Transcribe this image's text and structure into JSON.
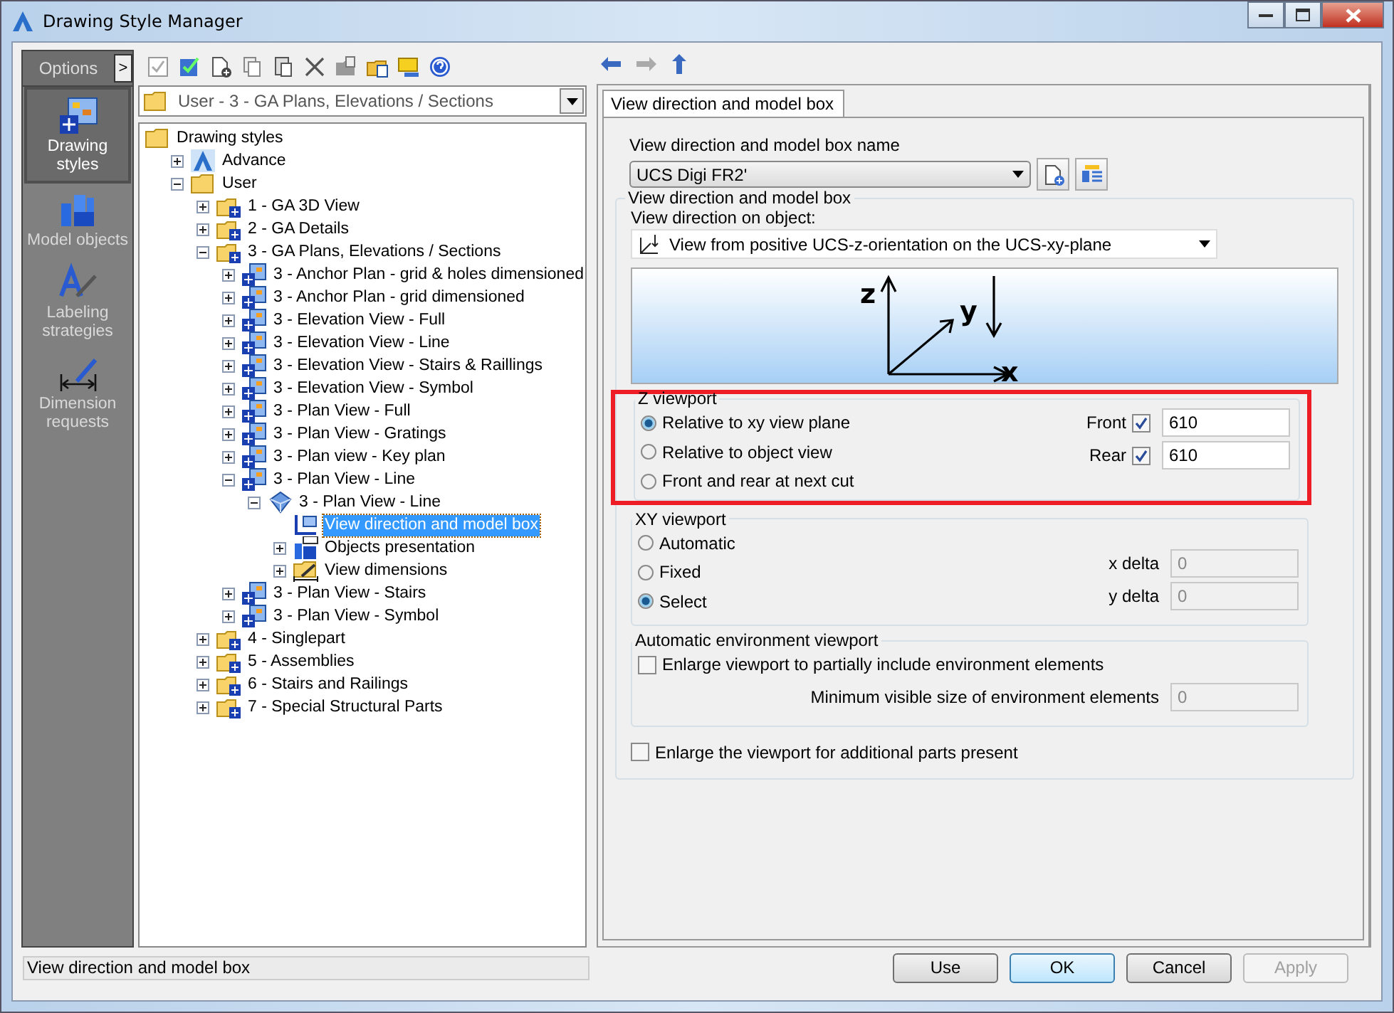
{
  "window": {
    "title": "Drawing Style Manager"
  },
  "sidebar": {
    "header": "Options",
    "expand_button": ">",
    "items": [
      {
        "label": "Drawing styles",
        "kind": "styles",
        "selected": true
      },
      {
        "label": "Model objects",
        "kind": "objects",
        "selected": false
      },
      {
        "label": "Labeling strategies",
        "kind": "labeling",
        "selected": false
      },
      {
        "label": "Dimension requests",
        "kind": "dimension",
        "selected": false
      }
    ]
  },
  "path_combo": {
    "value": "User - 3 - GA Plans, Elevations / Sections"
  },
  "tree": [
    {
      "label": "Drawing styles",
      "kind": "folder",
      "selected": false,
      "children": [
        {
          "label": "Advance",
          "kind": "logo",
          "expanded": false,
          "selected": false
        },
        {
          "label": "User",
          "kind": "folder",
          "expanded": true,
          "selected": false,
          "children": [
            {
              "label": "1 - GA 3D View",
              "kind": "style-folder",
              "expanded": false,
              "selected": false
            },
            {
              "label": "2 - GA Details",
              "kind": "style-folder",
              "expanded": false,
              "selected": false
            },
            {
              "label": "3 - GA Plans, Elevations / Sections",
              "kind": "style-folder",
              "expanded": true,
              "selected": false,
              "children": [
                {
                  "label": "3 - Anchor Plan - grid & holes dimensioned",
                  "kind": "style",
                  "expanded": false,
                  "selected": false
                },
                {
                  "label": "3 - Anchor Plan - grid dimensioned",
                  "kind": "style",
                  "expanded": false,
                  "selected": false
                },
                {
                  "label": "3 - Elevation View - Full",
                  "kind": "style",
                  "expanded": false,
                  "selected": false
                },
                {
                  "label": "3 - Elevation View - Line",
                  "kind": "style",
                  "expanded": false,
                  "selected": false
                },
                {
                  "label": "3 - Elevation View - Stairs & Raillings",
                  "kind": "style",
                  "expanded": false,
                  "selected": false
                },
                {
                  "label": "3 - Elevation View - Symbol",
                  "kind": "style",
                  "expanded": false,
                  "selected": false
                },
                {
                  "label": "3 - Plan View - Full",
                  "kind": "style",
                  "expanded": false,
                  "selected": false
                },
                {
                  "label": "3 - Plan View - Gratings",
                  "kind": "style",
                  "expanded": false,
                  "selected": false
                },
                {
                  "label": "3 - Plan view - Key plan",
                  "kind": "style",
                  "expanded": false,
                  "selected": false
                },
                {
                  "label": "3 - Plan View - Line",
                  "kind": "style",
                  "expanded": true,
                  "selected": false,
                  "children": [
                    {
                      "label": "3 - Plan View - Line",
                      "kind": "view",
                      "expanded": true,
                      "selected": false,
                      "children": [
                        {
                          "label": "View direction and model box",
                          "kind": "viewbox",
                          "selected": true
                        },
                        {
                          "label": "Objects presentation",
                          "kind": "objects",
                          "expanded": false,
                          "selected": false
                        },
                        {
                          "label": "View dimensions",
                          "kind": "dimensions",
                          "expanded": false,
                          "selected": false
                        }
                      ]
                    }
                  ]
                },
                {
                  "label": "3 - Plan View - Stairs",
                  "kind": "style",
                  "expanded": false,
                  "selected": false
                },
                {
                  "label": "3 - Plan View - Symbol",
                  "kind": "style",
                  "expanded": false,
                  "selected": false
                }
              ]
            },
            {
              "label": "4 - Singlepart",
              "kind": "style-folder",
              "expanded": false,
              "selected": false
            },
            {
              "label": "5 - Assemblies",
              "kind": "style-folder",
              "expanded": false,
              "selected": false
            },
            {
              "label": "6 - Stairs and Railings",
              "kind": "style-folder",
              "expanded": false,
              "selected": false
            },
            {
              "label": "7 - Special Structural Parts",
              "kind": "style-folder",
              "expanded": false,
              "selected": false
            }
          ]
        }
      ]
    }
  ],
  "tabs": [
    {
      "label": "View direction and model box",
      "selected": true
    }
  ],
  "form": {
    "name_label": "View direction and model box name",
    "name_value": "UCS Digi FR2'",
    "group_title": "View direction and model box",
    "view_direction_label": "View direction on object:",
    "view_direction_value": "View from positive UCS-z-orientation on the UCS-xy-plane",
    "axis_labels": [
      "z",
      "y",
      "x"
    ],
    "z_viewport": {
      "title": "Z viewport",
      "highlighted": true,
      "options": [
        {
          "label": "Relative to xy view plane",
          "selected": true
        },
        {
          "label": "Relative to object view",
          "selected": false
        },
        {
          "label": "Front and rear at next cut",
          "selected": false
        }
      ],
      "limits": [
        {
          "label": "Front",
          "checked": true,
          "value": "610"
        },
        {
          "label": "Rear",
          "checked": true,
          "value": "610"
        }
      ]
    },
    "xy_viewport": {
      "title": "XY viewport",
      "options": [
        {
          "label": "Automatic",
          "selected": false
        },
        {
          "label": "Fixed",
          "selected": false
        },
        {
          "label": "Select",
          "selected": true
        }
      ],
      "deltas": [
        {
          "label": "x delta",
          "value": "0",
          "disabled": true
        },
        {
          "label": "y delta",
          "value": "0",
          "disabled": true
        }
      ]
    },
    "environment": {
      "title": "Automatic environment viewport",
      "enlarge": {
        "label": "Enlarge viewport to partially include environment elements",
        "checked": false
      },
      "min_size": {
        "label": "Minimum visible size of environment elements",
        "value": "0",
        "disabled": true
      }
    },
    "additional_parts": {
      "label": "Enlarge the viewport for additional parts present",
      "checked": false
    }
  },
  "status_bar": {
    "text": "View direction and model box"
  },
  "buttons": [
    {
      "label": "Use",
      "default": false,
      "disabled": false
    },
    {
      "label": "OK",
      "default": true,
      "disabled": false
    },
    {
      "label": "Cancel",
      "default": false,
      "disabled": false
    },
    {
      "label": "Apply",
      "default": false,
      "disabled": true
    }
  ]
}
